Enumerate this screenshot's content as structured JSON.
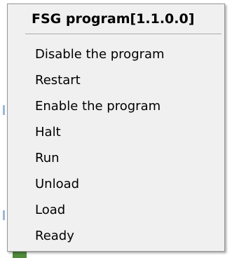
{
  "context_menu": {
    "title": "FSG program[1.1.0.0]",
    "items": [
      {
        "label": "Disable the program"
      },
      {
        "label": "Restart"
      },
      {
        "label": "Enable the program"
      },
      {
        "label": "Halt"
      },
      {
        "label": "Run"
      },
      {
        "label": "Unload"
      },
      {
        "label": "Load"
      },
      {
        "label": "Ready"
      }
    ]
  }
}
